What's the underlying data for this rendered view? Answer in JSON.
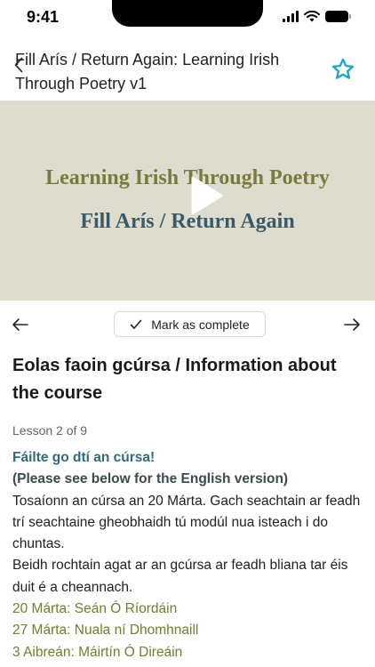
{
  "status_bar": {
    "time": "9:41"
  },
  "header": {
    "course_title": "Fill Arís / Return Again: Learning Irish Through Poetry v1",
    "accent_color": "#1aa6c9"
  },
  "video": {
    "title": "Learning Irish Through Poetry",
    "subtitle": "Fill Arís / Return Again",
    "background_color": "#dddcce"
  },
  "lesson_nav": {
    "mark_complete_label": "Mark as complete"
  },
  "lesson": {
    "heading": "Eolas faoin gcúrsa / Information about the course",
    "counter": "Lesson 2 of 9"
  },
  "content": {
    "welcome": "Fáilte go dtí an cúrsa!",
    "see_below": "(Please see below for the English version)",
    "paragraph_1": "Tosaíonn an cúrsa an 20 Márta. Gach seachtain ar feadh trí seachtaine gheobhaidh tú modúl nua isteach i do chuntas.",
    "paragraph_2": "Beidh rochtain agat ar an gcúrsa ar feadh bliana tar éis duit é a cheannach.",
    "schedule": [
      "20 Márta: Seán Ó Ríordáin",
      "27 Márta: Nuala ní Dhomhnaill",
      "3 Aibreán: Máirtín Ó Direáin"
    ]
  }
}
